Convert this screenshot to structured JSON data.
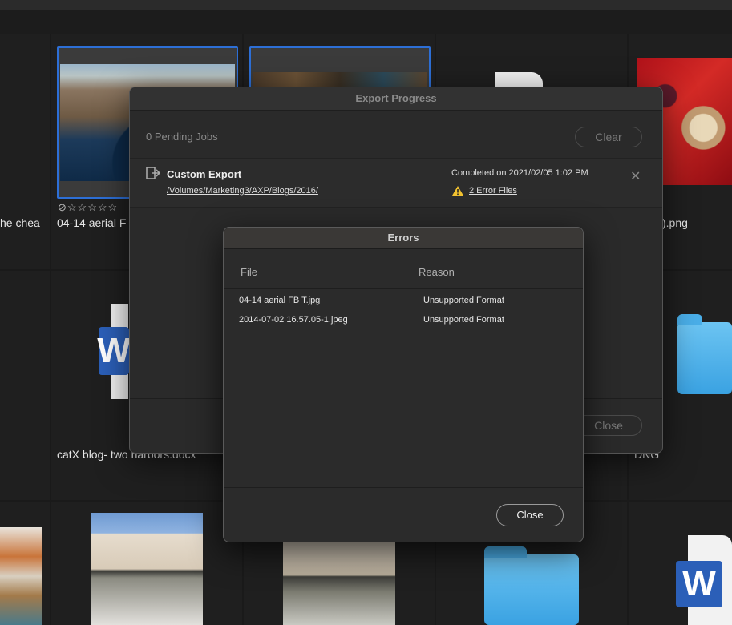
{
  "grid": {
    "labels": {
      "partial_left_top": "he chea",
      "aerial_label": "04-14 aerial F",
      "png_label": ").png",
      "docx_label": "catX blog- two harbors.docx",
      "dng_label": "DNG"
    },
    "rating_stars": "⊘☆☆☆☆☆",
    "icons": [
      "reject-icon",
      "star-icon",
      "word-icon",
      "folder-icon"
    ]
  },
  "export_progress": {
    "title": "Export Progress",
    "pending_jobs": "0 Pending Jobs",
    "clear_label": "Clear",
    "close_label": "Close",
    "job": {
      "name": "Custom Export",
      "path": "/Volumes/Marketing3/AXP/Blogs/2016/",
      "status": "Completed on 2021/02/05 1:02 PM",
      "errors_link": "2 Error Files",
      "dismiss_glyph": "✕"
    }
  },
  "errors_dialog": {
    "title": "Errors",
    "columns": {
      "file": "File",
      "reason": "Reason"
    },
    "rows": [
      {
        "file": "04-14 aerial FB T.jpg",
        "reason": "Unsupported Format"
      },
      {
        "file": "2014-07-02 16.57.05-1.jpeg",
        "reason": "Unsupported Format"
      }
    ],
    "close_label": "Close"
  },
  "colors": {
    "selection": "#2d6fd6",
    "warning": "#f2c230",
    "folder": "#3aa2e2",
    "word": "#2b5fb8"
  }
}
